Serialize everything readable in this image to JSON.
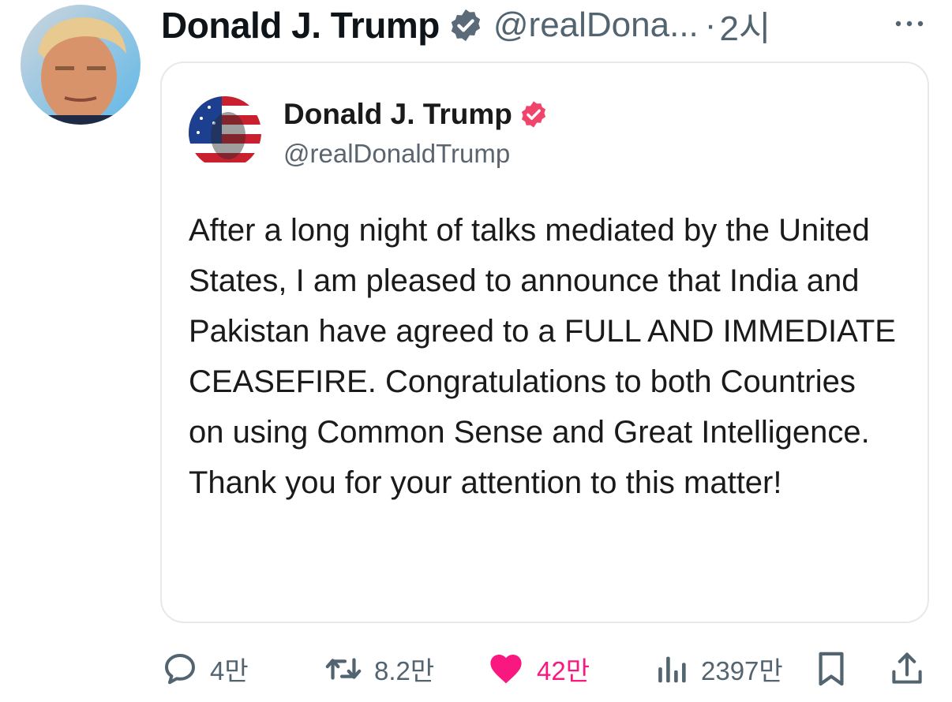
{
  "tweet": {
    "author_name": "Donald J. Trump",
    "author_handle": "@realDona...",
    "separator": "·",
    "time_ago": "2시",
    "avatar_icon": "profile-photo",
    "verified_color": "#5b6a78"
  },
  "quoted_post": {
    "author_name": "Donald J. Trump",
    "author_handle": "@realDonaldTrump",
    "badge_color": "#f0446b",
    "text": "After a long night of talks mediated by the United States, I am pleased to announce that India and Pakistan have agreed to a FULL AND IMMEDIATE CEASEFIRE. Congratulations to both Countries on using Common Sense and Great Intelligence. Thank you for your attention to this matter!"
  },
  "actions": {
    "reply_count": "4만",
    "retweet_count": "8.2만",
    "like_count": "42만",
    "views_count": "2397만",
    "like_color": "#f91880"
  }
}
